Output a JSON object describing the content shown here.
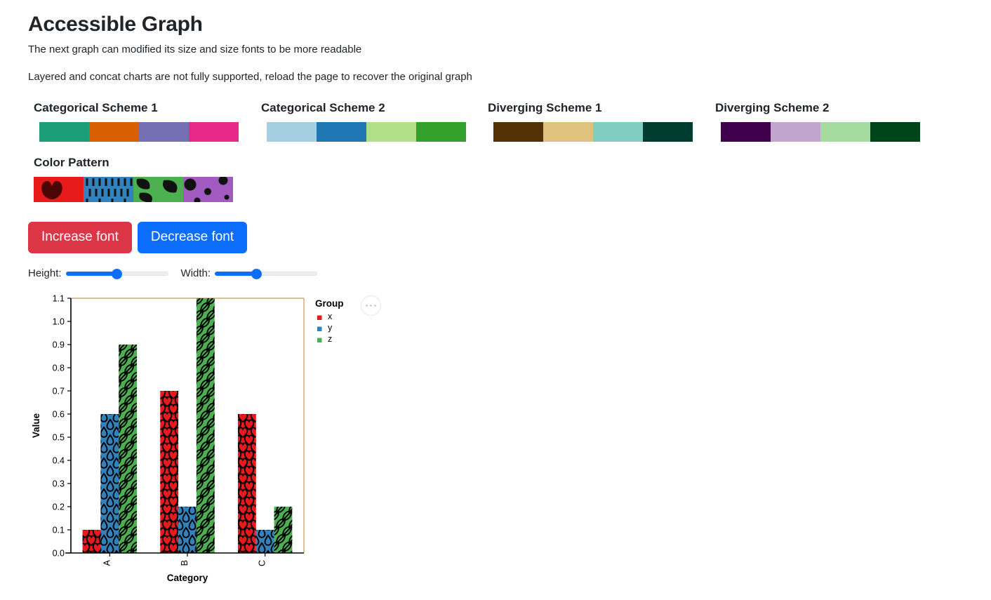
{
  "header": {
    "title": "Accessible Graph",
    "subtitle": "The next graph can modified its size and size fonts to be more readable",
    "notice": "Layered and concat charts are not fully supported, reload the page to recover the original graph"
  },
  "schemes": [
    {
      "name": "categorical-scheme-1",
      "title": "Categorical Scheme 1",
      "colors": [
        "#1b9e77",
        "#d95f02",
        "#7570b3",
        "#e7298a"
      ]
    },
    {
      "name": "categorical-scheme-2",
      "title": "Categorical Scheme 2",
      "colors": [
        "#a6cee3",
        "#1f78b4",
        "#b2df8a",
        "#33a02c"
      ]
    },
    {
      "name": "diverging-scheme-1",
      "title": "Diverging Scheme 1",
      "colors": [
        "#543005",
        "#dfc27d",
        "#80cdc1",
        "#003c30"
      ]
    },
    {
      "name": "diverging-scheme-2",
      "title": "Diverging Scheme 2",
      "colors": [
        "#40004b",
        "#c2a5cf",
        "#a6dba0",
        "#00441b"
      ]
    }
  ],
  "color_pattern": {
    "title": "Color Pattern",
    "swatches": [
      {
        "name": "heart-pattern-swatch",
        "color": "#e8191b",
        "pattern": "heart",
        "ink": "#4a0505"
      },
      {
        "name": "rain-pattern-swatch",
        "color": "#3182bd",
        "pattern": "rain",
        "ink": "#111111"
      },
      {
        "name": "leaf-pattern-swatch",
        "color": "#4caf50",
        "pattern": "leaf",
        "ink": "#111111"
      },
      {
        "name": "dot-pattern-swatch",
        "color": "#a05ac0",
        "pattern": "dot",
        "ink": "#111111"
      }
    ]
  },
  "controls": {
    "increase_font_label": "Increase font",
    "decrease_font_label": "Decrease font",
    "increase_font_color": "#dc3545",
    "decrease_font_color": "#0d6efd",
    "height_label": "Height:",
    "width_label": "Width:",
    "height_value": 50,
    "width_value": 40
  },
  "chart_data": {
    "type": "bar",
    "title": "",
    "xlabel": "Category",
    "ylabel": "Value",
    "categories": [
      "A",
      "B",
      "C"
    ],
    "series": [
      {
        "name": "x",
        "color": "#e8191b",
        "pattern": "heart",
        "values": [
          0.1,
          0.7,
          0.6
        ]
      },
      {
        "name": "y",
        "color": "#3182bd",
        "pattern": "rain",
        "values": [
          0.6,
          0.2,
          0.1
        ]
      },
      {
        "name": "z",
        "color": "#4caf50",
        "pattern": "leaf",
        "values": [
          0.9,
          1.1,
          0.2
        ]
      }
    ],
    "ylim": [
      0.0,
      1.1
    ],
    "yticks": [
      "0.0",
      "0.1",
      "0.2",
      "0.3",
      "0.4",
      "0.5",
      "0.6",
      "0.7",
      "0.8",
      "0.9",
      "1.0",
      "1.1"
    ],
    "grid": false,
    "legend": {
      "title": "Group",
      "position": "right",
      "entries": [
        {
          "label": "x",
          "color": "#e8191b"
        },
        {
          "label": "y",
          "color": "#3182bd"
        },
        {
          "label": "z",
          "color": "#4caf50"
        }
      ]
    },
    "plot_border_color": "#c8a878",
    "axis_color": "#000000"
  },
  "action_menu": {
    "name": "chart-actions-menu",
    "icon": "ellipsis-icon"
  }
}
